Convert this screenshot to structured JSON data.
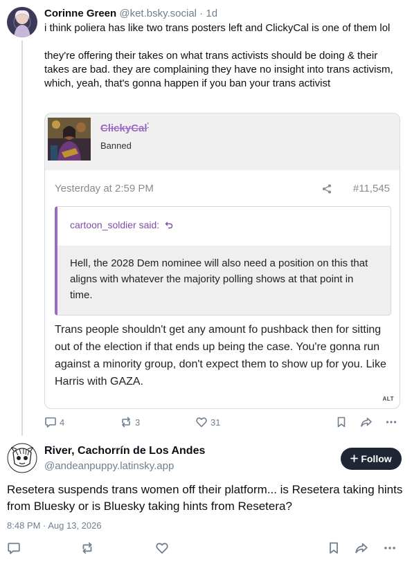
{
  "post1": {
    "author_name": "Corinne Green",
    "author_handle": "@ket.bsky.social",
    "separator": " · ",
    "age": "1d",
    "text_line1": "i think poliera has like two trans posters left and ClickyCal is one of them lol",
    "text_line2": "they're offering their takes on what trans activists should be doing & their takes are bad. they are complaining they have no insight into trans activism, which, yeah, that's gonna happen if you ban your trans activist",
    "embed": {
      "username": "ClickyCal",
      "username_mark": "'",
      "status": "Banned",
      "timestamp": "Yesterday at 2:59 PM",
      "post_number": "#11,545",
      "quote_author": "cartoon_soldier said:",
      "quote_text": "Hell, the 2028 Dem nominee will also need a position on this that aligns with whatever the majority polling shows at that point in time.",
      "reply_text": "Trans people shouldn't get any amount fo pushback then for sitting out of the election if that ends up being the case. You're gonna run against a minority group, don't expect them to show up for you. Like Harris with GAZA.",
      "alt_badge": "ALT"
    },
    "replies": "4",
    "reposts": "3",
    "likes": "31"
  },
  "post2": {
    "author_name": "River, Cachorrín de Los Andes",
    "author_handle": "@andeanpuppy.latinsky.app",
    "follow_label": "Follow",
    "text": "Resetera suspends trans women off their platform... is Resetera taking hints from Bluesky or is Bluesky taking hints from Resetera?",
    "timestamp": "8:48 PM · Aug 13, 2026"
  },
  "icons": {
    "reply": "speech-bubble-icon",
    "repost": "repost-arrows-icon",
    "like": "heart-icon",
    "bookmark": "bookmark-icon",
    "share": "share-arrow-icon",
    "more": "ellipsis-icon"
  },
  "colors": {
    "name_purple": "#9b6bc4",
    "quote_bar": "#9b6bc4",
    "follow_bg": "#1e2733",
    "muted": "#6f7f8f"
  }
}
